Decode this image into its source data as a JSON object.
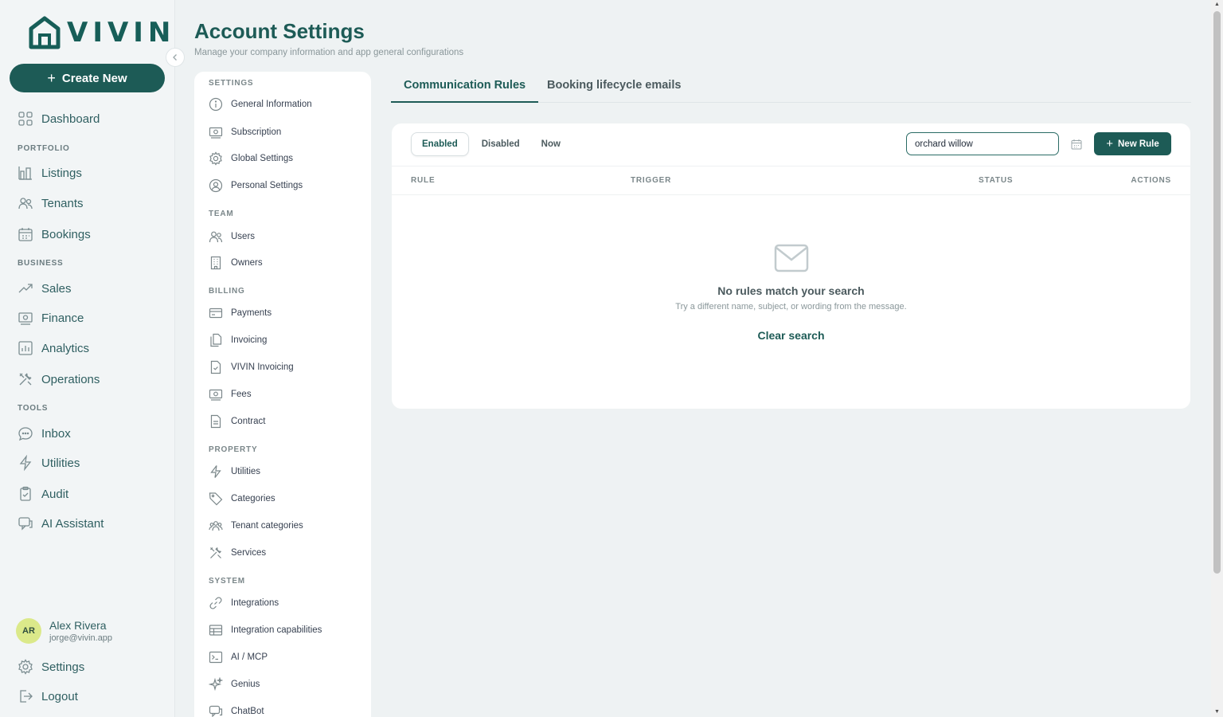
{
  "brand": {
    "name": "VIVIN"
  },
  "sidebar": {
    "create_label": "Create New",
    "dashboard": "Dashboard",
    "sections": {
      "portfolio": "PORTFOLIO",
      "business": "BUSINESS",
      "tools": "TOOLS"
    },
    "items": {
      "listings": "Listings",
      "tenants": "Tenants",
      "bookings": "Bookings",
      "sales": "Sales",
      "finance": "Finance",
      "analytics": "Analytics",
      "operations": "Operations",
      "inbox": "Inbox",
      "utilities": "Utilities",
      "audit": "Audit",
      "ai_assistant": "AI Assistant"
    },
    "user": {
      "initials": "AR",
      "name": "Alex Rivera",
      "email": "jorge@vivin.app"
    },
    "settings": "Settings",
    "logout": "Logout"
  },
  "header": {
    "title": "Account Settings",
    "subtitle": "Manage your company information and app general configurations"
  },
  "settings_menu": {
    "sections": {
      "settings": "SETTINGS",
      "team": "TEAM",
      "billing": "BILLING",
      "property": "PROPERTY",
      "system": "SYSTEM"
    },
    "items": {
      "general_information": "General Information",
      "subscription": "Subscription",
      "global_settings": "Global Settings",
      "personal_settings": "Personal Settings",
      "users": "Users",
      "owners": "Owners",
      "payments": "Payments",
      "invoicing": "Invoicing",
      "vivin_invoicing": "VIVIN Invoicing",
      "fees": "Fees",
      "contract": "Contract",
      "utilities": "Utilities",
      "categories": "Categories",
      "tenant_categories": "Tenant categories",
      "services": "Services",
      "integrations": "Integrations",
      "integration_capabilities": "Integration capabilities",
      "ai_mcp": "AI / MCP",
      "genius": "Genius",
      "chatbot": "ChatBot"
    }
  },
  "tabs": {
    "communication_rules": "Communication Rules",
    "booking_lifecycle": "Booking lifecycle emails"
  },
  "rules": {
    "filters": {
      "enabled": "Enabled",
      "disabled": "Disabled",
      "now": "Now"
    },
    "search": {
      "value": "orchard willow"
    },
    "new_rule_label": "New Rule",
    "columns": {
      "rule": "RULE",
      "trigger": "TRIGGER",
      "status": "STATUS",
      "actions": "ACTIONS"
    },
    "empty": {
      "title": "No rules match your search",
      "description": "Try a different name, subject, or wording from the message.",
      "clear_label": "Clear search"
    }
  },
  "colors": {
    "brand": "#1d5b56",
    "sidebar_bg": "#f2f5f6",
    "page_bg": "#eef2f3",
    "avatar_bg": "#dbe98a"
  }
}
